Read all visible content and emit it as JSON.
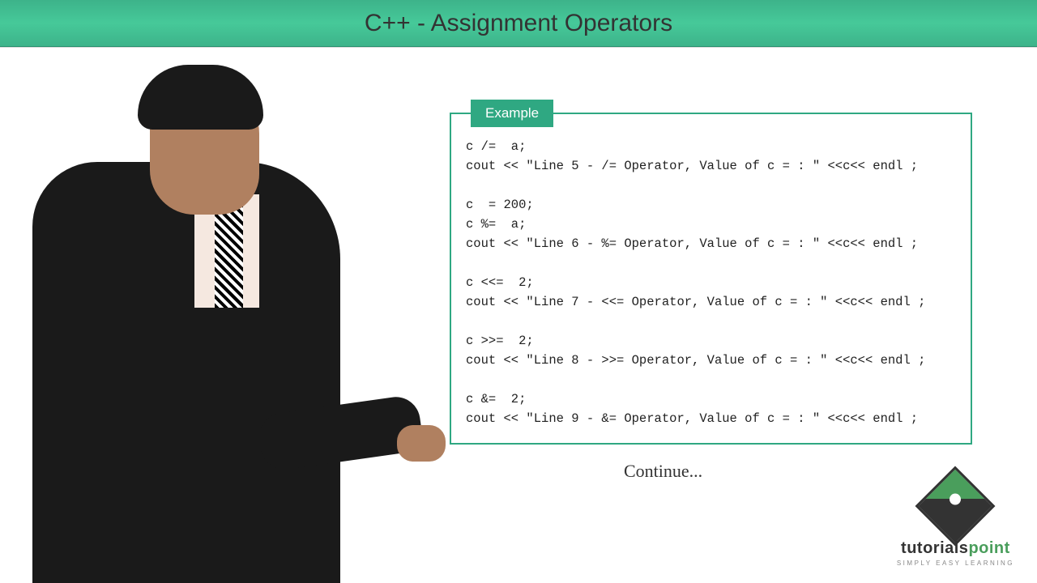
{
  "title": "C++ - Assignment Operators",
  "example_label": "Example",
  "code_lines": [
    "c /=  a;",
    "cout << \"Line 5 - /= Operator, Value of c = : \" <<c<< endl ;",
    "",
    "c  = 200;",
    "c %=  a;",
    "cout << \"Line 6 - %= Operator, Value of c = : \" <<c<< endl ;",
    "",
    "c <<=  2;",
    "cout << \"Line 7 - <<= Operator, Value of c = : \" <<c<< endl ;",
    "",
    "c >>=  2;",
    "cout << \"Line 8 - >>= Operator, Value of c = : \" <<c<< endl ;",
    "",
    "c &=  2;",
    "cout << \"Line 9 - &= Operator, Value of c = : \" <<c<< endl ;"
  ],
  "continue_text": "Continue...",
  "logo": {
    "name_part1": "tutorials",
    "name_part2": "point",
    "tagline": "SIMPLY EASY LEARNING"
  }
}
